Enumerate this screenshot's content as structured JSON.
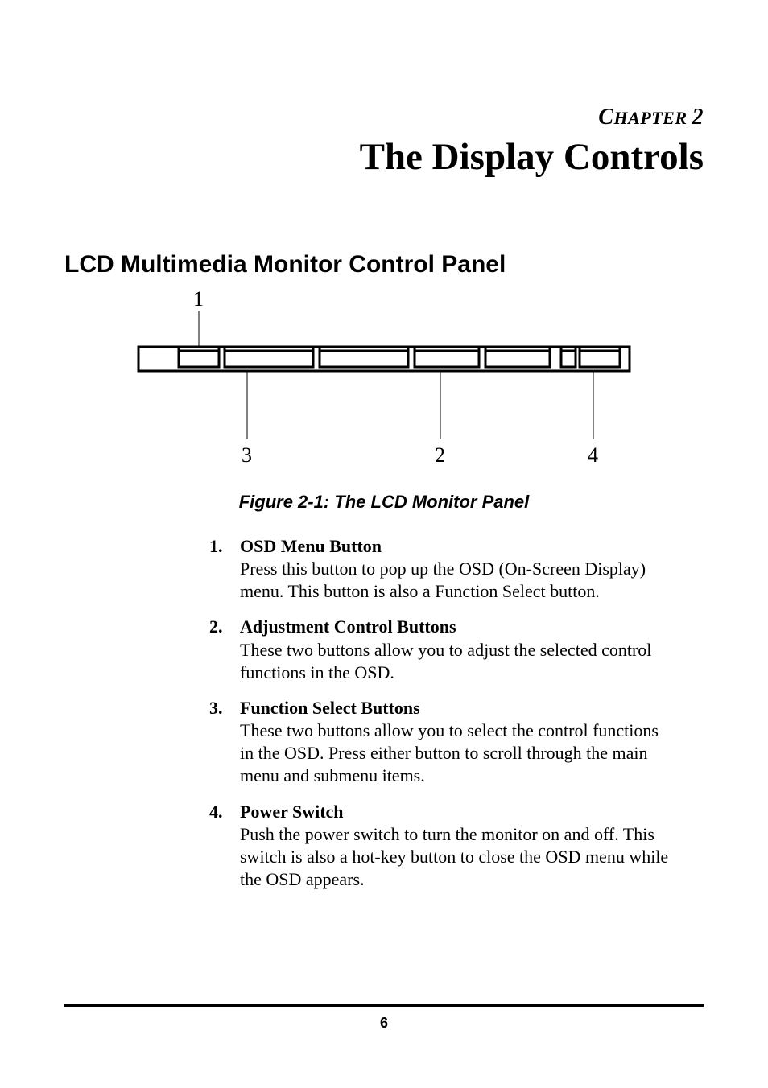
{
  "chapter": {
    "label_prefix": "C",
    "label_mid": "HAPTER ",
    "label_num": "2",
    "title": "The Display Controls"
  },
  "section": {
    "title": "LCD Multimedia Monitor Control Panel"
  },
  "figure": {
    "callouts": {
      "top": "1",
      "bottom_left": "3",
      "bottom_mid": "2",
      "bottom_right": "4"
    },
    "caption": "Figure 2-1: The LCD Monitor Panel"
  },
  "items": [
    {
      "num": "1.",
      "title": "OSD Menu Button",
      "desc": "Press this button to pop up the OSD (On-Screen Display) menu. This button is also a Function Select button."
    },
    {
      "num": "2.",
      "title": "Adjustment Control Buttons",
      "desc": "These two buttons allow you to adjust the selected control functions in the OSD."
    },
    {
      "num": "3.",
      "title": "Function Select Buttons",
      "desc": "These two buttons allow you to select the control functions in the OSD. Press either button to scroll through the main menu and submenu items."
    },
    {
      "num": "4.",
      "title": "Power Switch",
      "desc": "Push the power switch to turn the monitor on and off. This switch is also a hot-key button to close the OSD menu while the OSD appears."
    }
  ],
  "page_number": "6"
}
